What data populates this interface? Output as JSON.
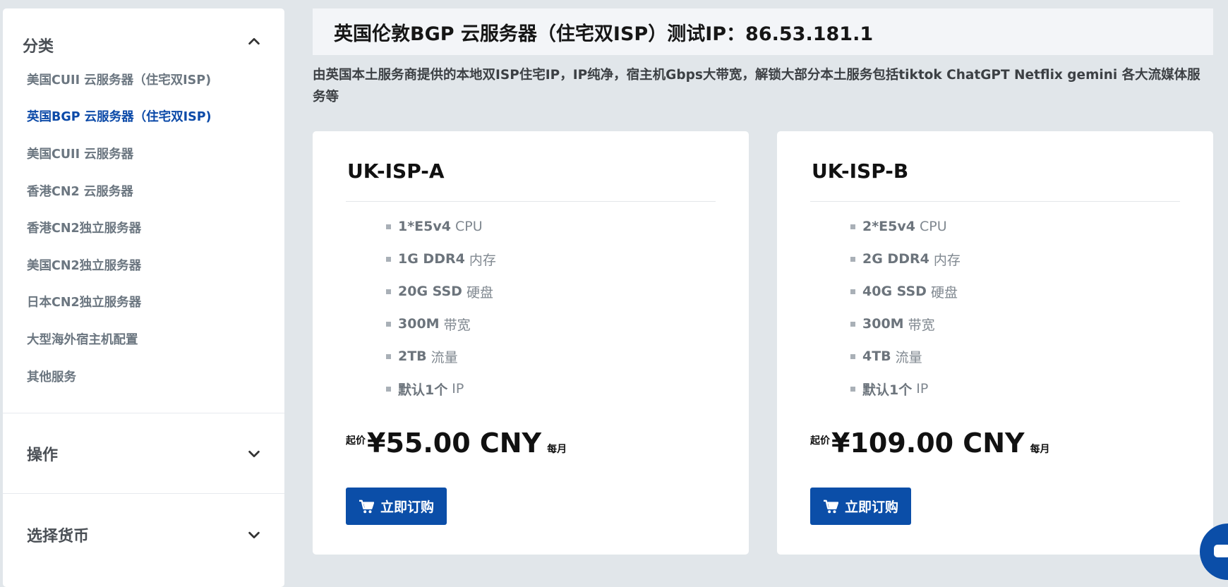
{
  "sidebar": {
    "categories": {
      "title": "分类",
      "items": [
        {
          "label": "美国CUII 云服务器（住宅双ISP)"
        },
        {
          "label": "英国BGP 云服务器（住宅双ISP)",
          "active": true
        },
        {
          "label": "美国CUII 云服务器"
        },
        {
          "label": "香港CN2 云服务器"
        },
        {
          "label": "香港CN2独立服务器"
        },
        {
          "label": "美国CN2独立服务器"
        },
        {
          "label": "日本CN2独立服务器"
        },
        {
          "label": "大型海外宿主机配置"
        },
        {
          "label": "其他服务"
        }
      ]
    },
    "actions": {
      "title": "操作"
    },
    "currency": {
      "title": "选择货币"
    }
  },
  "main": {
    "title": "英国伦敦BGP 云服务器（住宅双ISP）测试IP：86.53.181.1",
    "description": "由英国本土服务商提供的本地双ISP住宅IP，IP纯净，宿主机Gbps大带宽，解锁大部分本土服务包括tiktok ChatGPT Netflix gemini 各大流媒体服务等"
  },
  "products": [
    {
      "name": "UK-ISP-A",
      "specs": [
        {
          "value": "1*E5v4",
          "unit": "CPU"
        },
        {
          "value": "1G DDR4",
          "unit": "内存"
        },
        {
          "value": "20G SSD",
          "unit": "硬盘"
        },
        {
          "value": "300M",
          "unit": "带宽"
        },
        {
          "value": "2TB",
          "unit": "流量"
        },
        {
          "value": "默认1个",
          "unit": "IP"
        }
      ],
      "price_prefix": "起价",
      "price": "¥55.00 CNY",
      "cycle": "每月",
      "button": "立即订购"
    },
    {
      "name": "UK-ISP-B",
      "specs": [
        {
          "value": "2*E5v4",
          "unit": "CPU"
        },
        {
          "value": "2G DDR4",
          "unit": "内存"
        },
        {
          "value": "40G SSD",
          "unit": "硬盘"
        },
        {
          "value": "300M",
          "unit": "带宽"
        },
        {
          "value": "4TB",
          "unit": "流量"
        },
        {
          "value": "默认1个",
          "unit": "IP"
        }
      ],
      "price_prefix": "起价",
      "price": "¥109.00 CNY",
      "cycle": "每月",
      "button": "立即订购"
    }
  ],
  "colors": {
    "accent": "#0b4ea8",
    "active_link": "#0c4aa8",
    "page_bg": "#e1e6ea"
  },
  "icons": {
    "collapse": "chevron-up-icon",
    "expand": "chevron-down-icon",
    "cart": "shopping-cart-icon",
    "chat": "chat-icon"
  }
}
